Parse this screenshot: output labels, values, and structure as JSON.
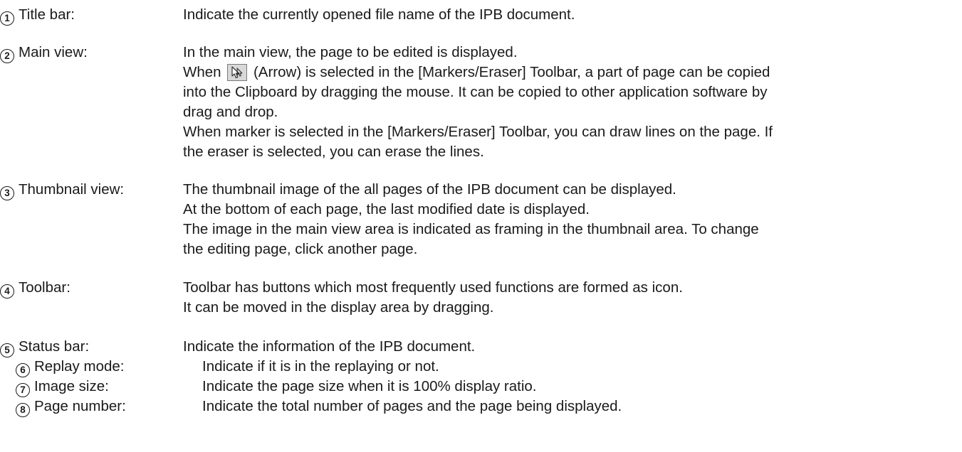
{
  "entries": [
    {
      "number": "1",
      "term": "Title bar:",
      "lines": [
        "Indicate the currently opened file name of the IPB document."
      ]
    },
    {
      "number": "2",
      "term": "Main view:",
      "lines": [
        "In the main view, the page to be edited is displayed.",
        {
          "before": "When",
          "icon": "arrow-cursor-icon",
          "after": "(Arrow) is selected in the [Markers/Eraser] Toolbar, a part of page can be copied"
        },
        "into the Clipboard by dragging the mouse. It can be copied to other application software by",
        "drag and drop.",
        "When marker is selected in the [Markers/Eraser] Toolbar, you can draw lines on the page. If",
        "the eraser is selected, you can erase the lines."
      ]
    },
    {
      "number": "3",
      "term": "Thumbnail view:",
      "lines": [
        "The thumbnail image of the all pages of the IPB document can be displayed.",
        "At the bottom of each page, the last modified date is displayed.",
        "The image in the main view area is indicated as framing in the thumbnail area. To change",
        "the editing page, click another page."
      ]
    },
    {
      "number": "4",
      "term": "Toolbar:",
      "lines": [
        "Toolbar has buttons which most frequently used functions are formed as icon.",
        "It can be moved in the display area by dragging."
      ]
    },
    {
      "number": "5",
      "term": "Status bar:",
      "lines": [
        "Indicate the information of the IPB document."
      ]
    }
  ],
  "subentries": [
    {
      "number": "6",
      "term": "Replay mode:",
      "text": "Indicate if it is in the replaying or not."
    },
    {
      "number": "7",
      "term": "Image size:",
      "text": "Indicate the page size when it is 100% display ratio."
    },
    {
      "number": "8",
      "term": "Page number:",
      "text": "Indicate the total number of pages and the page being displayed."
    }
  ]
}
